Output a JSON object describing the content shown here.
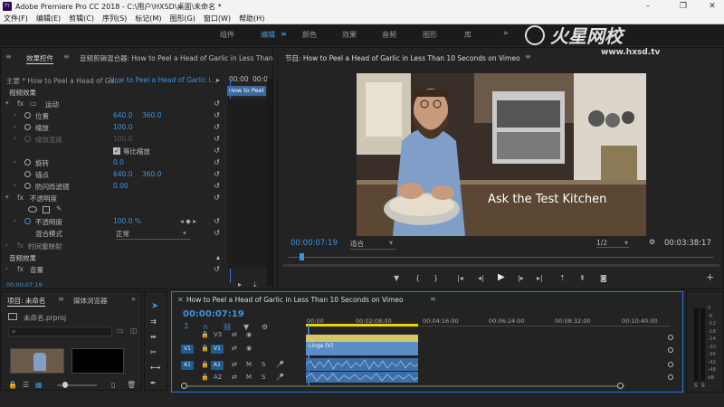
{
  "app": {
    "title": "Adobe Premiere Pro CC 2018 - C:\\用户\\HXSD\\桌面\\未命名 *"
  },
  "menu": [
    "文件(F)",
    "编辑(E)",
    "剪辑(C)",
    "序列(S)",
    "标记(M)",
    "图形(G)",
    "窗口(W)",
    "帮助(H)"
  ],
  "workspaces": [
    "组件",
    "编辑",
    "颜色",
    "效果",
    "音频",
    "图形",
    "库"
  ],
  "watermark": {
    "brand": "火星网校",
    "url": "www.hxsd.tv"
  },
  "effects_panel": {
    "tab_active": "效果控件",
    "tab_mixer": "音频剪辑混合器: How to Peel a Head of Garlic in Less Than",
    "master": "主要 * How to Peel a Head of Ga...",
    "clip": "How to Peel a Head of Garlic i...",
    "clip_tooltip": "How to Peel",
    "mini_time_1": "00:00",
    "mini_time_2": "00:0",
    "video_effects": "视频效果",
    "motion": "运动",
    "position_label": "位置",
    "position_x": "640.0",
    "position_y": "360.0",
    "scale_label": "缩放",
    "scale_value": "100.0",
    "scale_width_label": "缩放宽度",
    "scale_width_value": "100.0",
    "uniform_label": "等比缩放",
    "rotation_label": "旋转",
    "rotation_value": "0.0",
    "anchor_label": "锚点",
    "anchor_x": "640.0",
    "anchor_y": "360.0",
    "flicker_label": "防闪烁滤镜",
    "flicker_value": "0.00",
    "opacity": "不透明度",
    "opacity_label": "不透明度",
    "opacity_value": "100.0 %",
    "blend_label": "混合模式",
    "blend_value": "正常",
    "time_remap": "时间重映射",
    "audio_effects": "音频效果",
    "volume": "音量",
    "timecode": "00:00:07:19"
  },
  "program": {
    "title": "节目: How to Peel a Head of Garlic in Less Than 10 Seconds on Vimeo",
    "overlay_text": "Ask the Test Kitchen",
    "timecode": "00:00:07:19",
    "fit": "适合",
    "resolution": "1/2",
    "duration": "00:03:38:17"
  },
  "project": {
    "tab": "项目: 未命名",
    "tab2": "媒体浏览器",
    "file": "未命名.prproj"
  },
  "timeline": {
    "title": "How to Peel a Head of Garlic in Less Than 10 Seconds on Vimeo",
    "timecode": "00:00:07:19",
    "ruler": [
      "00:00",
      "00:02:08:00",
      "00:04:16:00",
      "00:06:24:00",
      "00:08:32:00",
      "00:10:40:00"
    ],
    "tracks": [
      {
        "src": "",
        "name": "V3"
      },
      {
        "src": "V1",
        "name": "V1"
      },
      {
        "src": "A1",
        "name": "A1"
      },
      {
        "src": "",
        "name": "A2"
      }
    ],
    "clip_video": "Linga [V]",
    "mute": "M",
    "solo": "S"
  },
  "meter": {
    "labels": [
      "0",
      "-6",
      "-12",
      "-18",
      "-24",
      "-30",
      "-36",
      "-42",
      "-48",
      "dB"
    ]
  },
  "colors": {
    "accent": "#3c93df",
    "clip_video": "#5b8dc7",
    "clip_audio": "#3d6fa8",
    "playhead": "#2b76d8"
  }
}
